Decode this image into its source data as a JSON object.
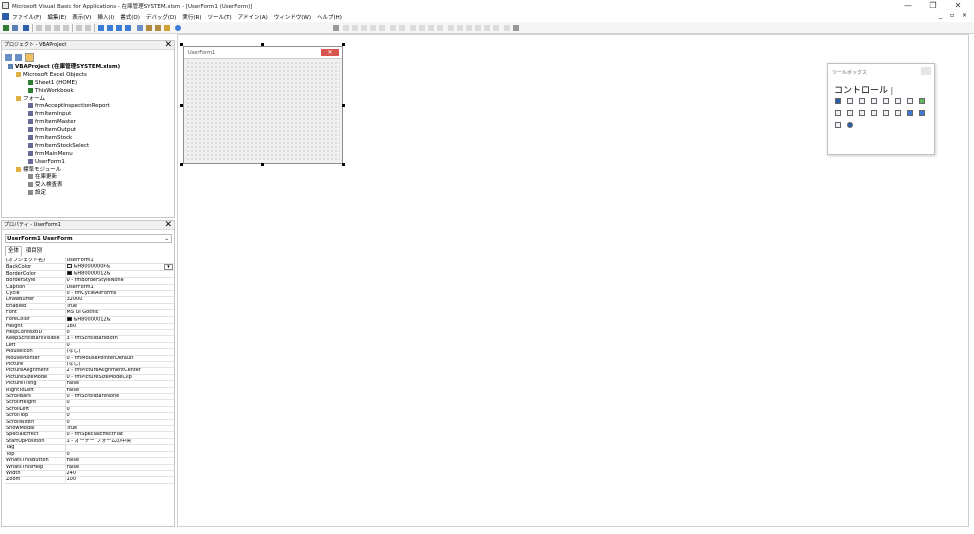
{
  "window": {
    "title": "Microsoft Visual Basic for Applications - 在庫管理SYSTEM.xlsm - [UserForm1 (UserForm)]",
    "minimize_glyph": "—",
    "restore_glyph": "❐",
    "close_glyph": "✕"
  },
  "menubar": {
    "items": [
      "ファイル(F)",
      "編集(E)",
      "表示(V)",
      "挿入(I)",
      "書式(O)",
      "デバッグ(D)",
      "実行(R)",
      "ツール(T)",
      "アドイン(A)",
      "ウィンドウ(W)",
      "ヘルプ(H)"
    ],
    "mdi_controls": "_ ▫ ×"
  },
  "project_explorer": {
    "title": "プロジェクト - VBAProject",
    "close_glyph": "✕",
    "root": "VBAProject (在庫管理SYSTEM.xlsm)",
    "excel_objects_folder": "Microsoft Excel Objects",
    "sheets": [
      "Sheet1 (HOME)",
      "ThisWorkbook"
    ],
    "forms_folder": "フォーム",
    "forms": [
      "frmAcceptInspectionReport",
      "frmItemInput",
      "frmItemMaster",
      "frmItemOutput",
      "frmItemStock",
      "frmItemStockSelect",
      "frmMainMenu",
      "UserForm1"
    ],
    "modules_folder": "標準モジュール",
    "modules": [
      "在庫更新",
      "受入検査表",
      "設定"
    ]
  },
  "properties": {
    "title": "プロパティ - UserForm1",
    "close_glyph": "✕",
    "object_select": "UserForm1 UserForm",
    "tabs": [
      "全体",
      "項目別"
    ],
    "rows": [
      {
        "name": "(オブジェクト名)",
        "value": "UserForm1"
      },
      {
        "name": "BackColor",
        "value": "&H8000000F&",
        "swatch": "#f0f0f0"
      },
      {
        "name": "BorderColor",
        "value": "&H80000012&",
        "swatch": "#000000"
      },
      {
        "name": "BorderStyle",
        "value": "0 - fmBorderStyleNone"
      },
      {
        "name": "Caption",
        "value": "UserForm1"
      },
      {
        "name": "Cycle",
        "value": "0 - fmCycleAllForms"
      },
      {
        "name": "DrawBuffer",
        "value": "32000"
      },
      {
        "name": "Enabled",
        "value": "True"
      },
      {
        "name": "Font",
        "value": "MS UI Gothic"
      },
      {
        "name": "ForeColor",
        "value": "&H80000012&",
        "swatch": "#000000"
      },
      {
        "name": "Height",
        "value": "180"
      },
      {
        "name": "HelpContextID",
        "value": "0"
      },
      {
        "name": "KeepScrollBarsVisible",
        "value": "3 - fmScrollBarsBoth"
      },
      {
        "name": "Left",
        "value": "0"
      },
      {
        "name": "MouseIcon",
        "value": "(なし)"
      },
      {
        "name": "MousePointer",
        "value": "0 - fmMousePointerDefault"
      },
      {
        "name": "Picture",
        "value": "(なし)"
      },
      {
        "name": "PictureAlignment",
        "value": "2 - fmPictureAlignmentCenter"
      },
      {
        "name": "PictureSizeMode",
        "value": "0 - fmPictureSizeModeClip"
      },
      {
        "name": "PictureTiling",
        "value": "False"
      },
      {
        "name": "RightToLeft",
        "value": "False"
      },
      {
        "name": "ScrollBars",
        "value": "0 - fmScrollBarsNone"
      },
      {
        "name": "ScrollHeight",
        "value": "0"
      },
      {
        "name": "ScrollLeft",
        "value": "0"
      },
      {
        "name": "ScrollTop",
        "value": "0"
      },
      {
        "name": "ScrollWidth",
        "value": "0"
      },
      {
        "name": "ShowModal",
        "value": "True"
      },
      {
        "name": "SpecialEffect",
        "value": "0 - fmSpecialEffectFlat"
      },
      {
        "name": "StartUpPosition",
        "value": "1 - オーナー フォームの中央"
      },
      {
        "name": "Tag",
        "value": ""
      },
      {
        "name": "Top",
        "value": "0"
      },
      {
        "name": "WhatsThisButton",
        "value": "False"
      },
      {
        "name": "WhatsThisHelp",
        "value": "False"
      },
      {
        "name": "Width",
        "value": "240"
      },
      {
        "name": "Zoom",
        "value": "100"
      }
    ]
  },
  "userform": {
    "caption": "UserForm1",
    "close_glyph": "✕"
  },
  "toolbox": {
    "title": "ツールボックス",
    "tab_label": "コントロール"
  }
}
